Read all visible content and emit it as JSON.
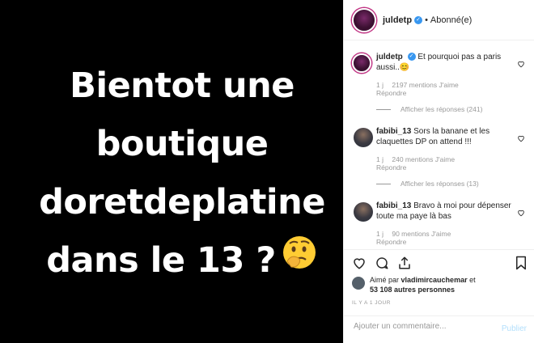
{
  "post": {
    "lines": [
      "Bientot une",
      "boutique",
      "doretdeplatine",
      "dans le 13 ?"
    ],
    "emoji": "thinking-face"
  },
  "header": {
    "username": "juldetp",
    "separator": "•",
    "follow_status": "Abonné(e)"
  },
  "comments": [
    {
      "username": "juldetp",
      "text": "Et pourquoi pas a paris aussi..😊",
      "time": "1 j",
      "likes": "2197 mentions J'aime",
      "reply_label": "Répondre",
      "view_replies": "Afficher les réponses (241)"
    },
    {
      "username": "fabibi_13",
      "text": "Sors la banane et les claquettes DP on attend !!!",
      "time": "1 j",
      "likes": "240 mentions J'aime",
      "reply_label": "Répondre",
      "view_replies": "Afficher les réponses (13)"
    },
    {
      "username": "fabibi_13",
      "text": "Bravo à moi pour dépenser toute ma paye là bas",
      "time": "1 j",
      "likes": "90 mentions J'aime",
      "reply_label": "Répondre"
    }
  ],
  "likes_summary": {
    "prefix": "Aimé par",
    "user": "vladimircauchemar",
    "joiner": "et",
    "others": "53 108 autres personnes"
  },
  "timestamp": "IL Y A 1 JOUR",
  "add_comment": {
    "placeholder": "Ajouter un commentaire...",
    "publish_label": "Publier"
  },
  "colors": {
    "accent_blue": "#3897f0",
    "publish_disabled": "#b2dffc",
    "muted_text": "#999999",
    "story_ring": "#c13584"
  }
}
